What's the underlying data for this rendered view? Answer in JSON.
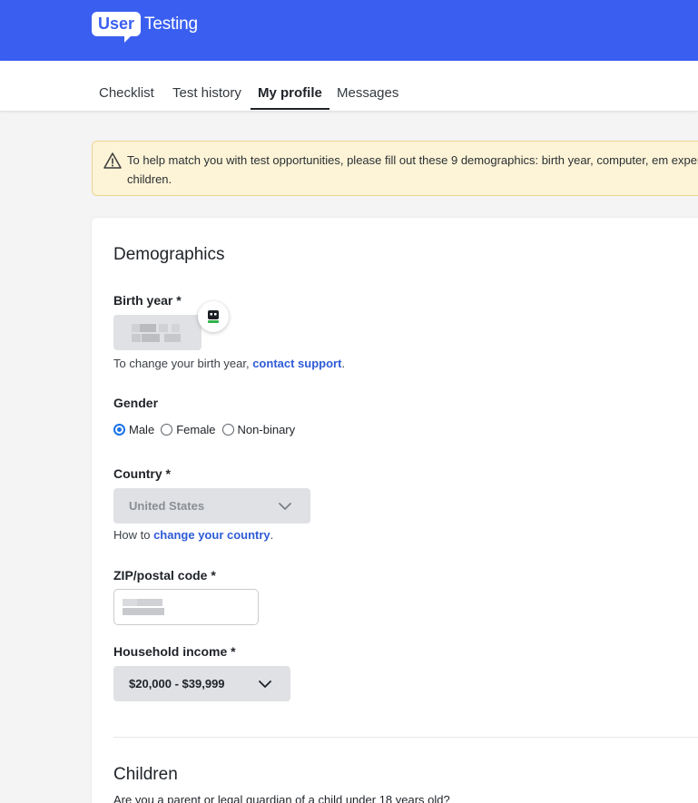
{
  "app": {
    "logo_badge": "User",
    "logo_text": "Testing"
  },
  "tabs": [
    {
      "label": "Checklist"
    },
    {
      "label": "Test history"
    },
    {
      "label": "My profile"
    },
    {
      "label": "Messages"
    }
  ],
  "alert": {
    "icon": "warning-icon",
    "text": "To help match you with test opportunities, please fill out these 9 demographics: birth year, computer, em expertise, children."
  },
  "demographics": {
    "heading": "Demographics",
    "birth_year": {
      "label": "Birth year *",
      "help_prefix": "To change your birth year, ",
      "help_link": "contact support",
      "help_suffix": "."
    },
    "gender": {
      "label": "Gender",
      "options": [
        "Male",
        "Female",
        "Non-binary"
      ],
      "selected": "Male"
    },
    "country": {
      "label": "Country *",
      "value": "United States",
      "help_prefix": "How to ",
      "help_link": "change your country",
      "help_suffix": "."
    },
    "zip": {
      "label": "ZIP/postal code *"
    },
    "income": {
      "label": "Household income *",
      "value": "$20,000 - $39,999"
    }
  },
  "children": {
    "heading": "Children",
    "question": "Are you a parent or legal guardian of a child under 18 years old?"
  },
  "colors": {
    "brand": "#3a5ff0",
    "link": "#2f5bd7",
    "alert_bg": "#fdf4d7",
    "radio_checked": "#1a73e8"
  }
}
